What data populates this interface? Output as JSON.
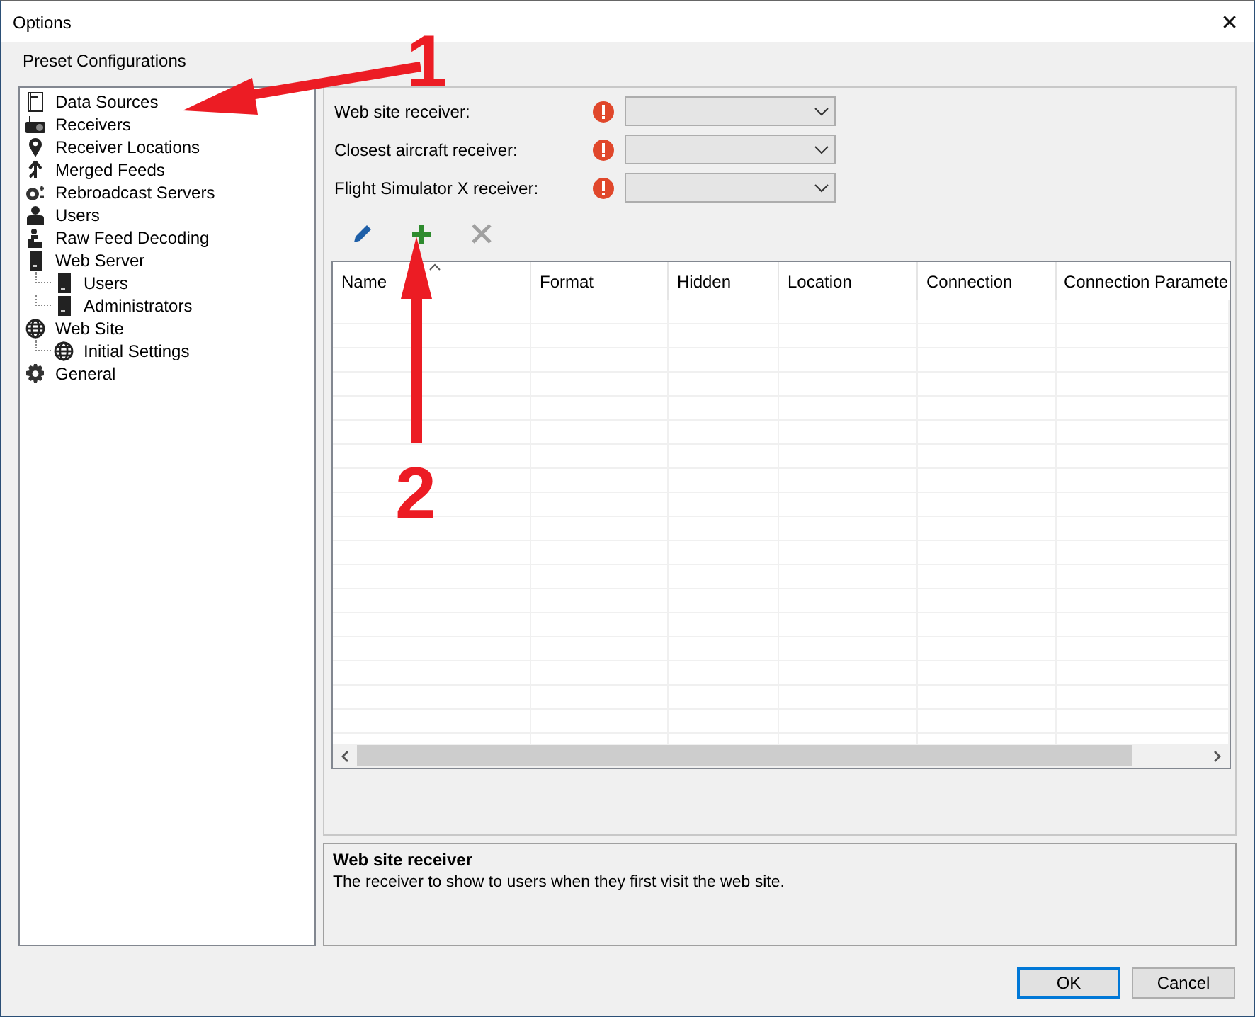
{
  "window": {
    "title": "Options",
    "close": "✕"
  },
  "section_title": "Preset Configurations",
  "tree": [
    {
      "label": "Data Sources"
    },
    {
      "label": "Receivers"
    },
    {
      "label": "Receiver Locations"
    },
    {
      "label": "Merged Feeds"
    },
    {
      "label": "Rebroadcast Servers"
    },
    {
      "label": "Users"
    },
    {
      "label": "Raw Feed Decoding"
    },
    {
      "label": "Web Server",
      "children": [
        {
          "label": "Users"
        },
        {
          "label": "Administrators"
        }
      ]
    },
    {
      "label": "Web Site",
      "children": [
        {
          "label": "Initial Settings"
        }
      ]
    },
    {
      "label": "General"
    }
  ],
  "fields": [
    {
      "label": "Web site receiver:",
      "error": true
    },
    {
      "label": "Closest aircraft receiver:",
      "error": true
    },
    {
      "label": "Flight Simulator X receiver:",
      "error": true
    }
  ],
  "toolbar": [
    {
      "kind": "edit",
      "disabled": false
    },
    {
      "kind": "add",
      "disabled": false
    },
    {
      "kind": "delete",
      "disabled": true
    }
  ],
  "table": {
    "columns": [
      {
        "label": "Name",
        "sorted": true
      },
      {
        "label": "Format",
        "sorted": false
      },
      {
        "label": "Hidden",
        "sorted": false
      },
      {
        "label": "Location",
        "sorted": false
      },
      {
        "label": "Connection",
        "sorted": false
      },
      {
        "label": "Connection Paramete",
        "sorted": false
      }
    ]
  },
  "description": {
    "title": "Web site receiver",
    "text": "The receiver to show to users when they first visit the web site."
  },
  "buttons": [
    {
      "label": "OK",
      "default": true
    },
    {
      "label": "Cancel",
      "default": false
    }
  ],
  "annotations": [
    {
      "label": "1"
    },
    {
      "label": "2"
    }
  ]
}
